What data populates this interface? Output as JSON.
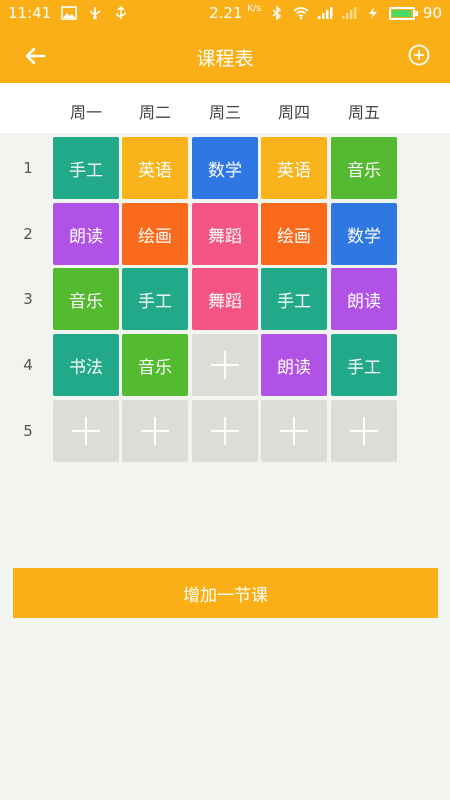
{
  "status_bar": {
    "time": "11:41",
    "speed": "2.21",
    "speed_unit": "K/s",
    "battery": "90",
    "icons": [
      "image-icon",
      "usb-icon",
      "usb-debug-icon",
      "bluetooth-icon",
      "wifi-icon",
      "signal-icon",
      "signal-weak-icon",
      "charging-icon",
      "battery-icon"
    ]
  },
  "app_bar": {
    "title": "课程表",
    "back_icon": "back-arrow-icon",
    "add_icon": "add-circle-icon"
  },
  "days": [
    "周一",
    "周二",
    "周三",
    "周四",
    "周五"
  ],
  "periods": [
    "1",
    "2",
    "3",
    "4",
    "5"
  ],
  "colors": {
    "primary": "#fbaf16",
    "background": "#f2f4ef",
    "empty_cell": "#dcdcd8",
    "teal": "#21a98a",
    "amber": "#f9b31b",
    "blue": "#2f78e4",
    "green": "#54ba2f",
    "purple": "#b052e6",
    "orange": "#f96a1c",
    "pink": "#f45484"
  },
  "schedule": [
    [
      {
        "name": "手工",
        "color": "#21a98a"
      },
      {
        "name": "英语",
        "color": "#f9b31b"
      },
      {
        "name": "数学",
        "color": "#2f78e4"
      },
      {
        "name": "英语",
        "color": "#f9b31b"
      },
      {
        "name": "音乐",
        "color": "#54ba2f"
      }
    ],
    [
      {
        "name": "朗读",
        "color": "#b052e6"
      },
      {
        "name": "绘画",
        "color": "#f96a1c"
      },
      {
        "name": "舞蹈",
        "color": "#f45484"
      },
      {
        "name": "绘画",
        "color": "#f96a1c"
      },
      {
        "name": "数学",
        "color": "#2f78e4"
      }
    ],
    [
      {
        "name": "音乐",
        "color": "#54ba2f"
      },
      {
        "name": "手工",
        "color": "#21a98a"
      },
      {
        "name": "舞蹈",
        "color": "#f45484"
      },
      {
        "name": "手工",
        "color": "#21a98a"
      },
      {
        "name": "朗读",
        "color": "#b052e6"
      }
    ],
    [
      {
        "name": "书法",
        "color": "#21a98a"
      },
      {
        "name": "音乐",
        "color": "#54ba2f"
      },
      null,
      {
        "name": "朗读",
        "color": "#b052e6"
      },
      {
        "name": "手工",
        "color": "#21a98a"
      }
    ],
    [
      null,
      null,
      null,
      null,
      null
    ]
  ],
  "add_lesson_button": "增加一节课"
}
